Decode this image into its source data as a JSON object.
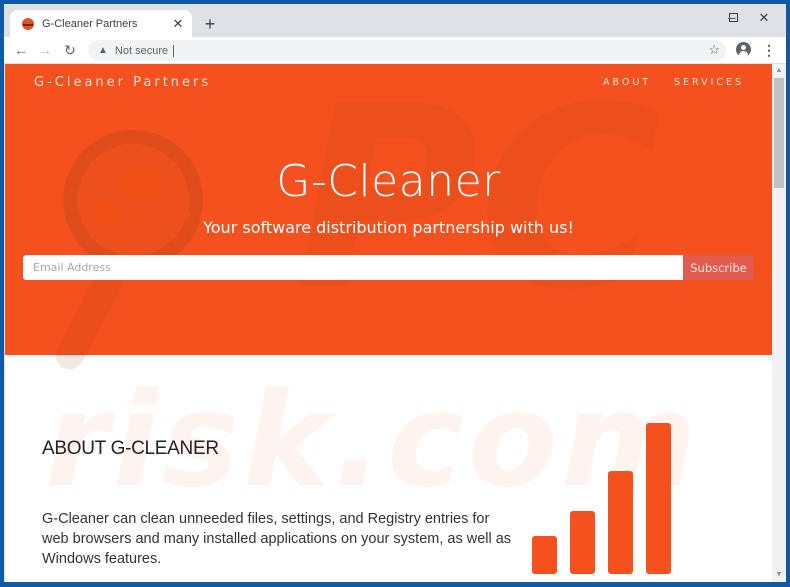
{
  "browser": {
    "tab": {
      "title": "G-Cleaner Partners",
      "favicon": "g-cleaner-favicon",
      "close_icon": "✕"
    },
    "new_tab_icon": "+",
    "window_controls": {
      "minimize": "–",
      "maximize": "☐",
      "close": "✕"
    },
    "nav": {
      "back": "←",
      "forward": "→",
      "reload": "↻"
    },
    "omnibox": {
      "security_icon": "▲",
      "security_text": "Not secure",
      "url": ""
    },
    "bookmark_icon": "☆",
    "menu_icon": "⋮"
  },
  "page": {
    "brand": "G-Cleaner Partners",
    "nav_links": [
      {
        "label": "ABOUT"
      },
      {
        "label": "SERVICES"
      }
    ],
    "hero": {
      "title": "G-Cleaner",
      "subtitle": "Your software distribution partnership with us!",
      "email_placeholder": "Email Address",
      "email_value": "",
      "subscribe_label": "Subscribe"
    },
    "about": {
      "heading": "ABOUT G-CLEANER",
      "body": "G-Cleaner can clean unneeded files, settings, and Registry entries for web browsers and many installed applications on your system, as well as Windows features."
    },
    "bar_graphic": {
      "relative_heights": [
        0.25,
        0.42,
        0.68,
        1.0
      ],
      "color": "#f4511e"
    },
    "colors": {
      "accent": "#f4511e",
      "subscribe": "#e25b4f"
    },
    "watermark": {
      "text": "risk.com",
      "prefix": "PC"
    }
  }
}
